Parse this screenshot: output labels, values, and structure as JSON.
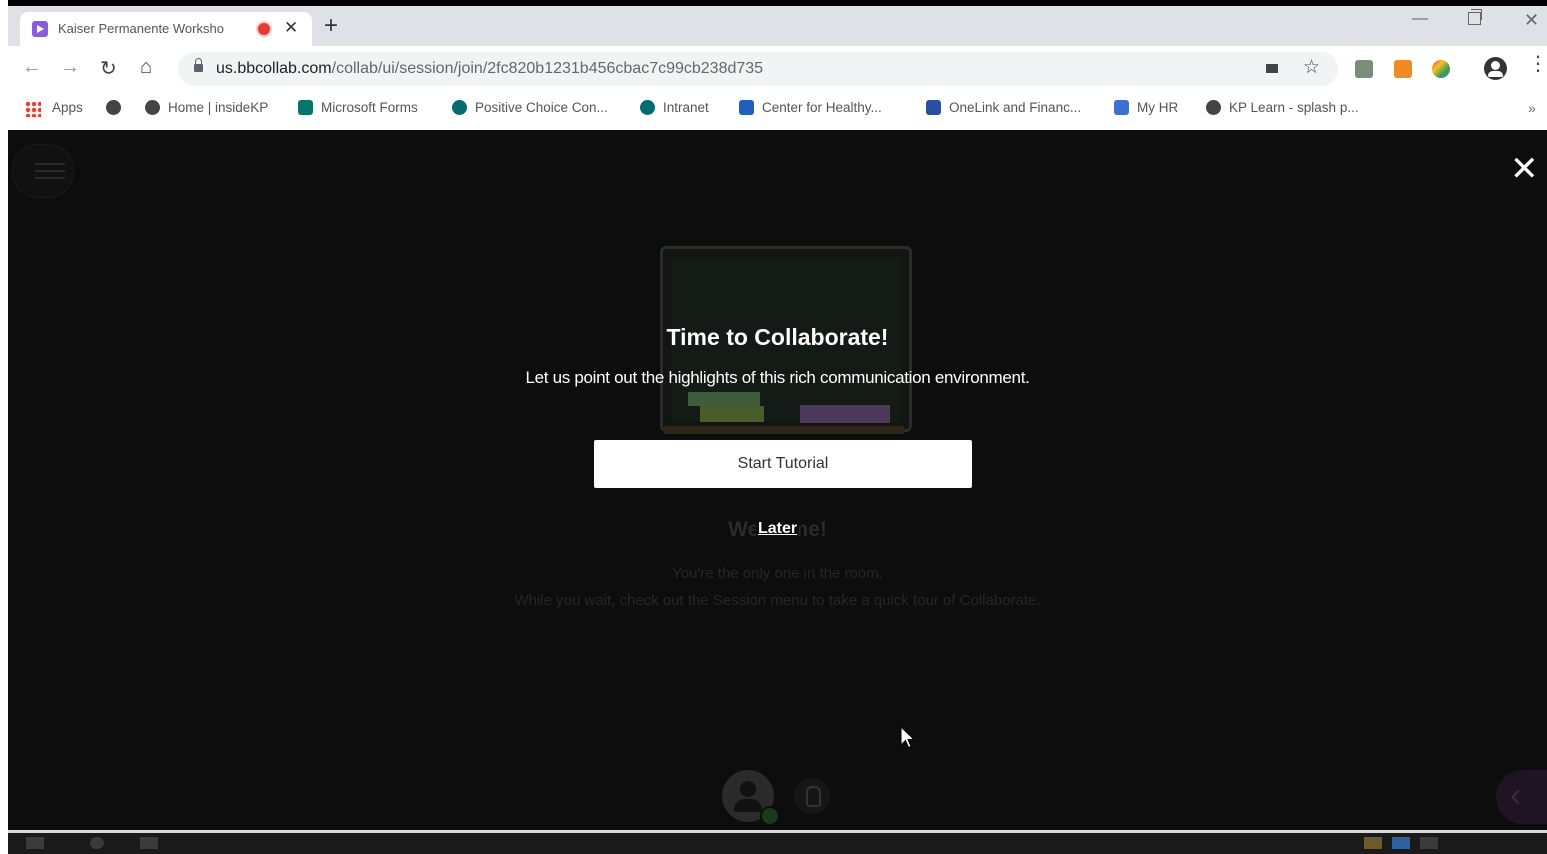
{
  "browser": {
    "tab": {
      "title": "Kaiser Permanente Worksho",
      "recording": true
    },
    "url": {
      "host": "us.bbcollab.com",
      "path": "/collab/ui/session/join/2fc820b1231b456cbac7c99cb238d735"
    },
    "bookmarks": [
      {
        "label": "Apps",
        "icon": "apps-grid-icon"
      },
      {
        "label": "",
        "icon": "globe-icon"
      },
      {
        "label": "Home | insideKP",
        "icon": "globe-icon"
      },
      {
        "label": "Microsoft Forms",
        "icon": "forms-icon"
      },
      {
        "label": "Positive Choice Con...",
        "icon": "sharepoint-icon"
      },
      {
        "label": "Intranet",
        "icon": "sharepoint-icon"
      },
      {
        "label": "Center for Healthy...",
        "icon": "document-icon"
      },
      {
        "label": "OneLink and Financ...",
        "icon": "people-icon"
      },
      {
        "label": "My HR",
        "icon": "calendar-icon"
      },
      {
        "label": "KP Learn - splash p...",
        "icon": "globe-icon"
      }
    ],
    "bookmarks_overflow": "»"
  },
  "dialog": {
    "title": "Time to Collaborate!",
    "subtitle": "Let us point out the highlights of this rich communication environment.",
    "start_label": "Start Tutorial",
    "later_label": "Later"
  },
  "background": {
    "welcome": "Welcome!",
    "line1": "You're the only one in the room.",
    "line2": "While you wait, check out the Session menu to take a quick tour of Collaborate."
  },
  "colors": {
    "app_background": "#0d0d0d",
    "primary_button": "#ffffff",
    "text": "#ffffff"
  }
}
